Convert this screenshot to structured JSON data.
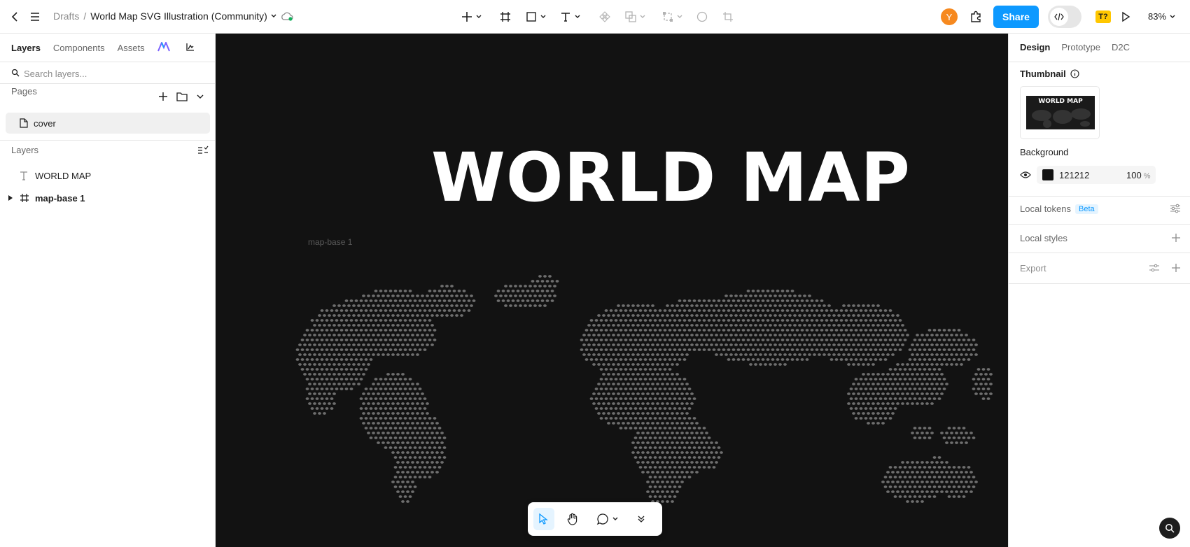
{
  "topbar": {
    "breadcrumb_folder": "Drafts",
    "breadcrumb_sep": "/",
    "file_name": "World Map SVG Illustration (Community)",
    "avatar_initial": "Y",
    "share_label": "Share",
    "plugin_badge": "T?",
    "zoom": "83%",
    "icons": [
      "back-icon",
      "menu-icon",
      "cloud-synced-icon",
      "plus-icon",
      "frame-icon",
      "rectangle-icon",
      "text-icon",
      "component-icon",
      "boolean-icon",
      "instance-icon",
      "ellipse-icon",
      "crop-icon",
      "plugins-icon",
      "code-icon",
      "play-icon"
    ],
    "accent": "#0d99ff"
  },
  "left_panel": {
    "tabs": [
      "Layers",
      "Components",
      "Assets"
    ],
    "search_placeholder": "Search layers...",
    "pages_header": "Pages",
    "pages": [
      {
        "name": "cover"
      }
    ],
    "layers_header": "Layers",
    "layers": [
      {
        "name": "WORLD MAP",
        "type": "text"
      },
      {
        "name": "map-base 1",
        "type": "frame"
      }
    ]
  },
  "canvas": {
    "background": "#121212",
    "frame_label": "map-base 1",
    "title_text": "WORLD MAP"
  },
  "right_panel": {
    "tabs": [
      "Design",
      "Prototype",
      "D2C"
    ],
    "thumbnail_label": "Thumbnail",
    "thumbnail_text": "WORLD MAP",
    "background_label": "Background",
    "background_hex": "121212",
    "background_opacity": "100",
    "opacity_unit": "%",
    "local_tokens_label": "Local tokens",
    "beta_label": "Beta",
    "local_styles_label": "Local styles",
    "export_label": "Export"
  }
}
